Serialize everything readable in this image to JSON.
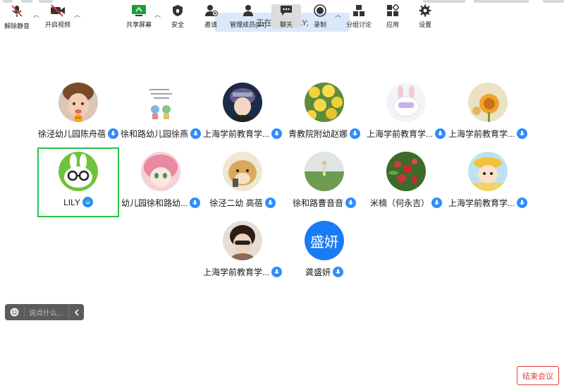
{
  "speaking_banner": "正在讲话: LILY;",
  "participants": [
    {
      "name": "徐泾幼儿园陈舟蓓",
      "avatar": "photo-child-icon",
      "mic": "mic-icon"
    },
    {
      "name": "徐和路幼儿园徐燕",
      "avatar": "drawing-icon",
      "mic": "mic-icon"
    },
    {
      "name": "上海学前教育学...",
      "avatar": "anime-girl-icon",
      "mic": "mic-icon"
    },
    {
      "name": "青教院附幼赵娜",
      "avatar": "flowers-icon",
      "mic": "mic-icon"
    },
    {
      "name": "上海学前教育学...",
      "avatar": "bunny-icon",
      "mic": "mic-icon"
    },
    {
      "name": "上海学前教育学...",
      "avatar": "sunflower-icon",
      "mic": "mic-icon"
    },
    {
      "name": "LILY",
      "avatar": "rabbit-glasses-icon",
      "mic": "mic-speaking-icon",
      "active": true
    },
    {
      "name": "幼儿园徐和路幼...",
      "avatar": "anime-pink-icon",
      "mic": "mic-icon"
    },
    {
      "name": "徐泾二幼 高蓓",
      "avatar": "dog-icon",
      "mic": "mic-icon"
    },
    {
      "name": "徐和路曹音音",
      "avatar": "field-icon",
      "mic": "mic-icon"
    },
    {
      "name": "米楠（何永吉）",
      "avatar": "berries-icon",
      "mic": "mic-icon"
    },
    {
      "name": "上海学前教育学...",
      "avatar": "cartoon-girl-icon",
      "mic": "mic-icon"
    },
    {
      "name": "上海学前教育学...",
      "avatar": "photo-girl-icon",
      "mic": "mic-icon"
    },
    {
      "name": "龚盛妍",
      "avatar_text": "盛妍",
      "avatar_color": "#1a7cf5",
      "mic": "mic-icon"
    }
  ],
  "chat_bubble": {
    "placeholder": "说点什么...",
    "emoji": "smile-icon",
    "collapse": "chevron-left-icon"
  },
  "toolbar": {
    "unmute": "解除静音",
    "video": "开启视频",
    "share": "共享屏幕",
    "security": "安全",
    "invite": "邀请",
    "participants": "管理成员(14)",
    "chat": "聊天",
    "record": "录制",
    "breakout": "分组讨论",
    "apps": "应用",
    "settings": "设置",
    "end": "结束会议"
  },
  "colors": {
    "accent": "#2d8cff",
    "active_border": "#27c34a",
    "end_red": "#e23c3c"
  }
}
